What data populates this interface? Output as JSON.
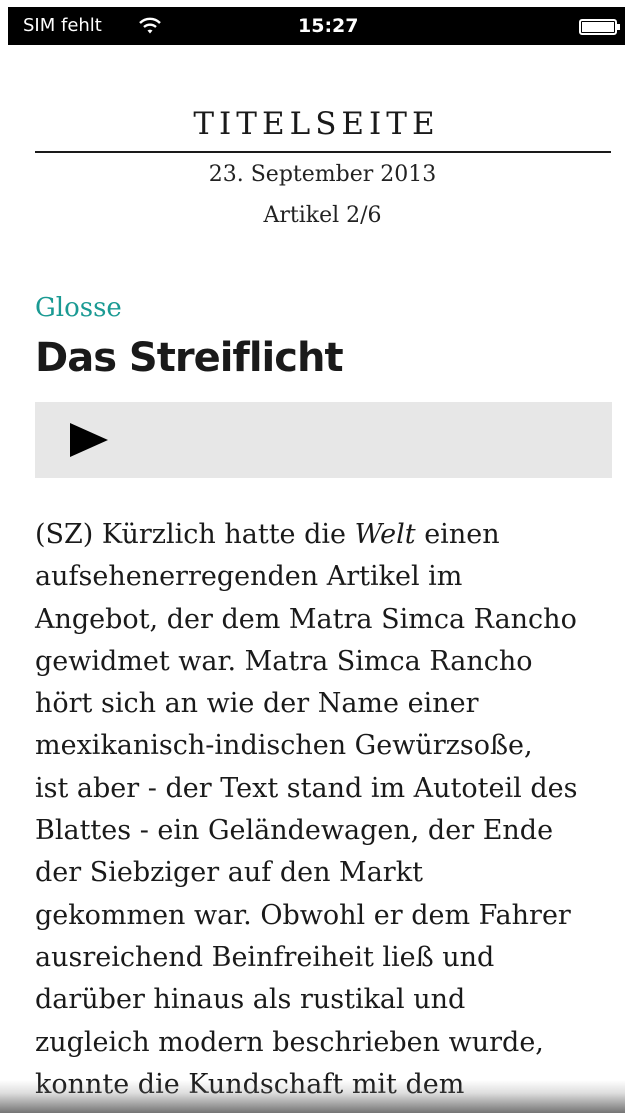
{
  "status_bar": {
    "carrier": "SIM fehlt",
    "time": "15:27",
    "icons": [
      "wifi-icon",
      "battery-icon"
    ]
  },
  "header": {
    "section": "TITELSEITE",
    "date": "23. September 2013",
    "article_count": "Artikel 2/6"
  },
  "article": {
    "kicker": "Glosse",
    "headline": "Das Streiflicht",
    "player": {
      "icon": "play-icon",
      "state": "paused"
    },
    "body_lines": [
      {
        "before": "(SZ) Kürzlich hatte die ",
        "em": "Welt",
        "after": " einen"
      },
      {
        "before": "aufsehenerregenden Artikel im"
      },
      {
        "before": "Angebot, der dem Matra Simca Rancho"
      },
      {
        "before": "gewidmet war. Matra Simca Rancho"
      },
      {
        "before": "hört sich an wie der Name einer"
      },
      {
        "before": "mexikanisch-indischen Gewürzsoße,"
      },
      {
        "before": "ist aber - der Text stand im Autoteil des"
      },
      {
        "before": "Blattes - ein Geländewagen, der Ende"
      },
      {
        "before": "der Siebziger auf den Markt"
      },
      {
        "before": "gekommen war. Obwohl er dem Fahrer"
      },
      {
        "before": "ausreichend Beinfreiheit ließ und"
      },
      {
        "before": "darüber hinaus als rustikal und"
      },
      {
        "before": "zugleich modern beschrieben wurde,"
      },
      {
        "before": "konnte die Kundschaft mit dem"
      }
    ]
  },
  "colors": {
    "accent": "#1a9a93",
    "status_bar": "#000000",
    "player_background": "#e7e7e7",
    "text": "#1a1a1a"
  }
}
